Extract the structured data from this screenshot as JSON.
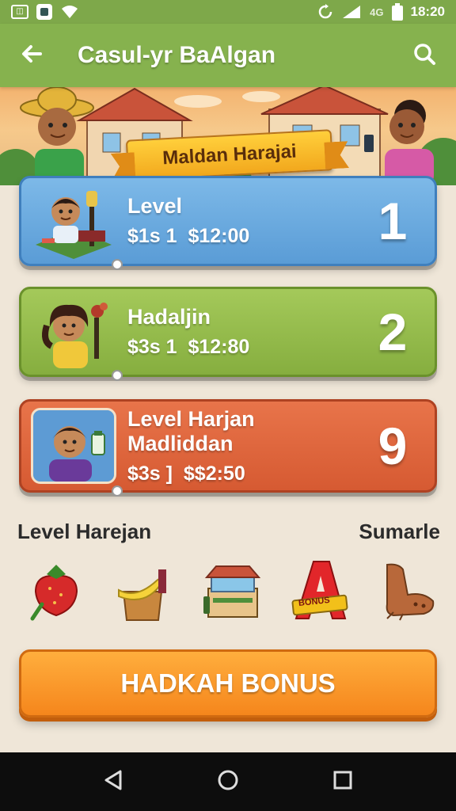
{
  "status_bar": {
    "left_icon": "notification-icon",
    "time": "18:20",
    "network": "4G"
  },
  "app_bar": {
    "title": "Casul-yr BaAlgan",
    "back_icon": "arrow-left-icon",
    "search_icon": "search-icon"
  },
  "banner": {
    "ribbon_text": "Maldan Harajai"
  },
  "levels": [
    {
      "title": "Level",
      "price_1": "$1s 1",
      "price_2": "$12:00",
      "level": "1",
      "color": "#6aaae0"
    },
    {
      "title": "Hadaljin",
      "price_1": "$3s 1",
      "price_2": "$12:80",
      "level": "2",
      "color": "#94bb4b"
    },
    {
      "title": "Level Harjan Madliddan",
      "price_1": "$3s ]",
      "price_2": "$$2:50",
      "level": "9",
      "color": "#df6640"
    }
  ],
  "items_section": {
    "left_label": "Level Harejan",
    "right_label": "Sumarle",
    "items": [
      {
        "icon": "strawberry-icon"
      },
      {
        "icon": "banana-crate-icon"
      },
      {
        "icon": "shop-stall-icon"
      },
      {
        "icon": "letter-a-icon",
        "badge": "BONUS"
      },
      {
        "icon": "boot-icon"
      }
    ]
  },
  "bonus_button": {
    "label": "HADKAH BONUS",
    "color": "#f5861c"
  },
  "nav_bar": {
    "back": "back-triangle-icon",
    "home": "home-circle-icon",
    "recents": "recents-square-icon"
  }
}
